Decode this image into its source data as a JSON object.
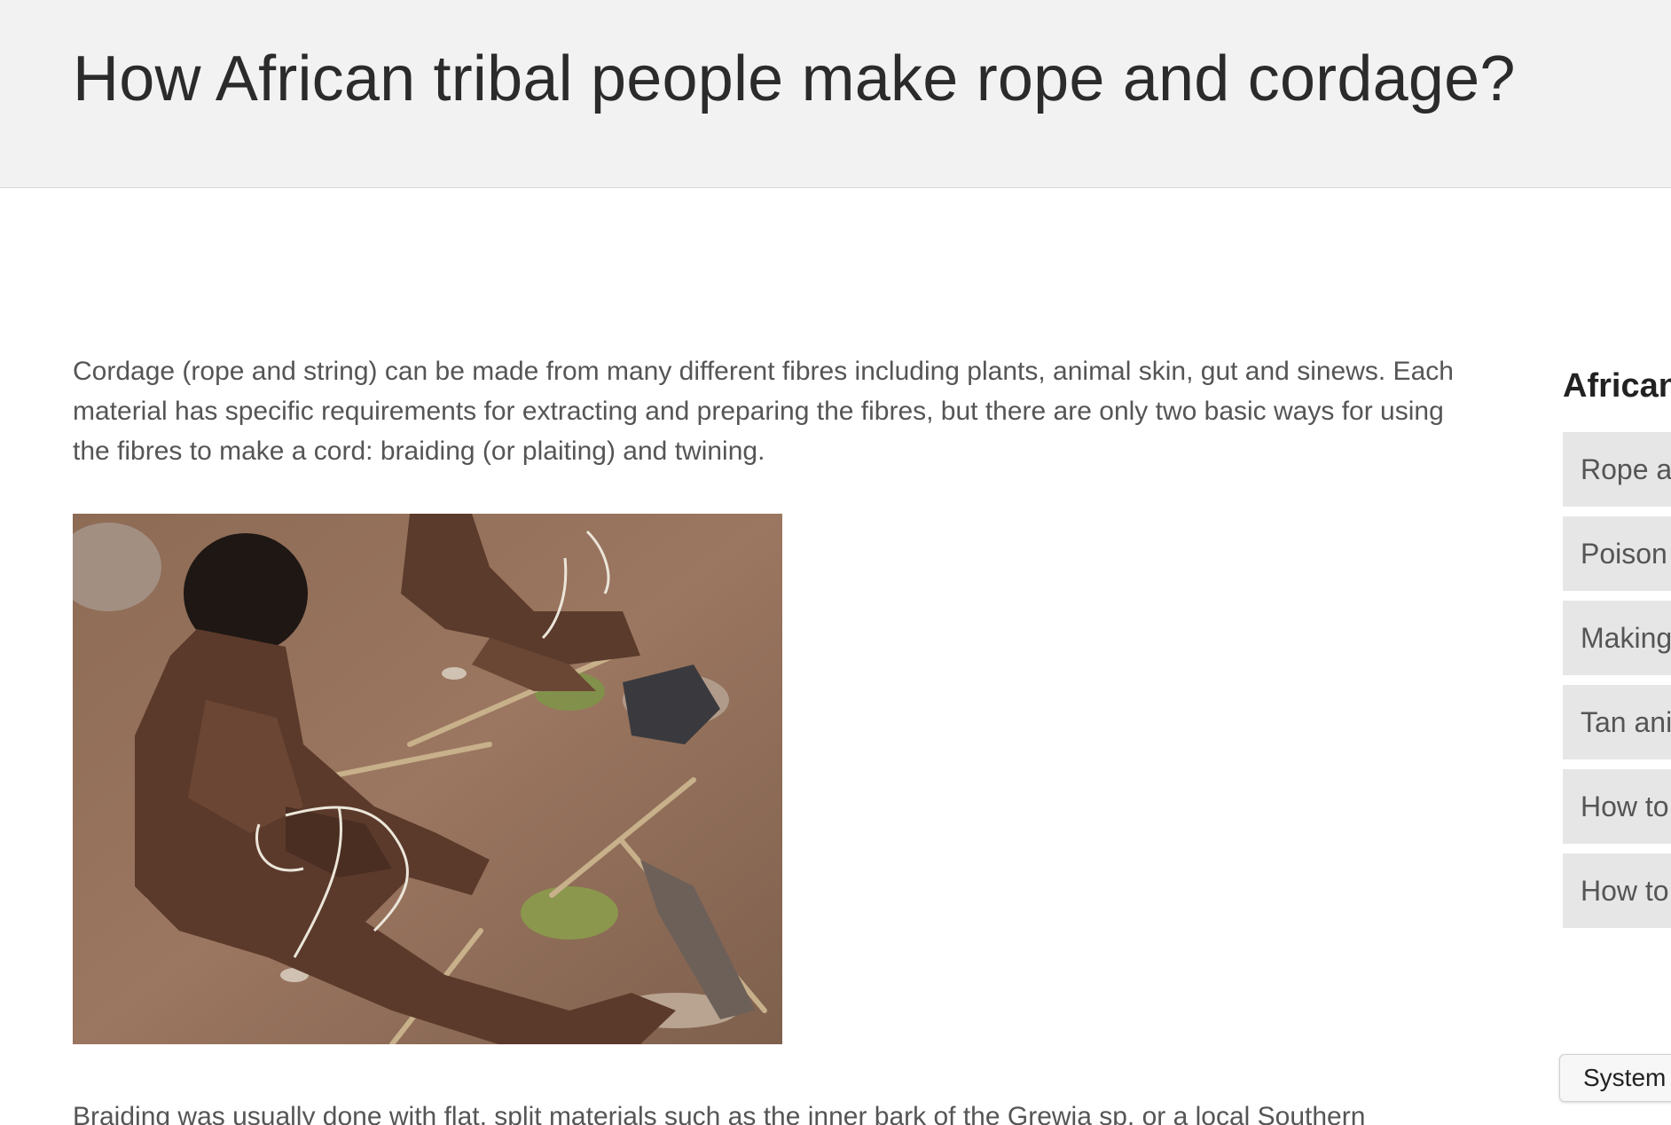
{
  "header": {
    "title": "How African tribal people make rope and cordage?"
  },
  "article": {
    "intro": "Cordage (rope and string) can be made from many different fibres including plants, animal skin, gut and sinews. Each material has specific requirements for extracting and preparing the fibres, but there are only two basic ways for using the fibres to make a cord: braiding (or plaiting) and twining.",
    "paragraph2": "Braiding was usually done with flat, split materials such as the inner bark of the Grewia sp. or a local Southern"
  },
  "sidebar": {
    "heading": "African",
    "items": [
      {
        "label": "Rope a"
      },
      {
        "label": "Poison"
      },
      {
        "label": "Making"
      },
      {
        "label": "Tan ani"
      },
      {
        "label": "How to"
      },
      {
        "label": "How to"
      }
    ]
  },
  "system_button": {
    "label": "System"
  },
  "colors": {
    "header_bg": "#f2f2f2",
    "title_text": "#2b2b2b",
    "body_text": "#555555",
    "sidebar_item_bg": "#e6e6e6"
  }
}
